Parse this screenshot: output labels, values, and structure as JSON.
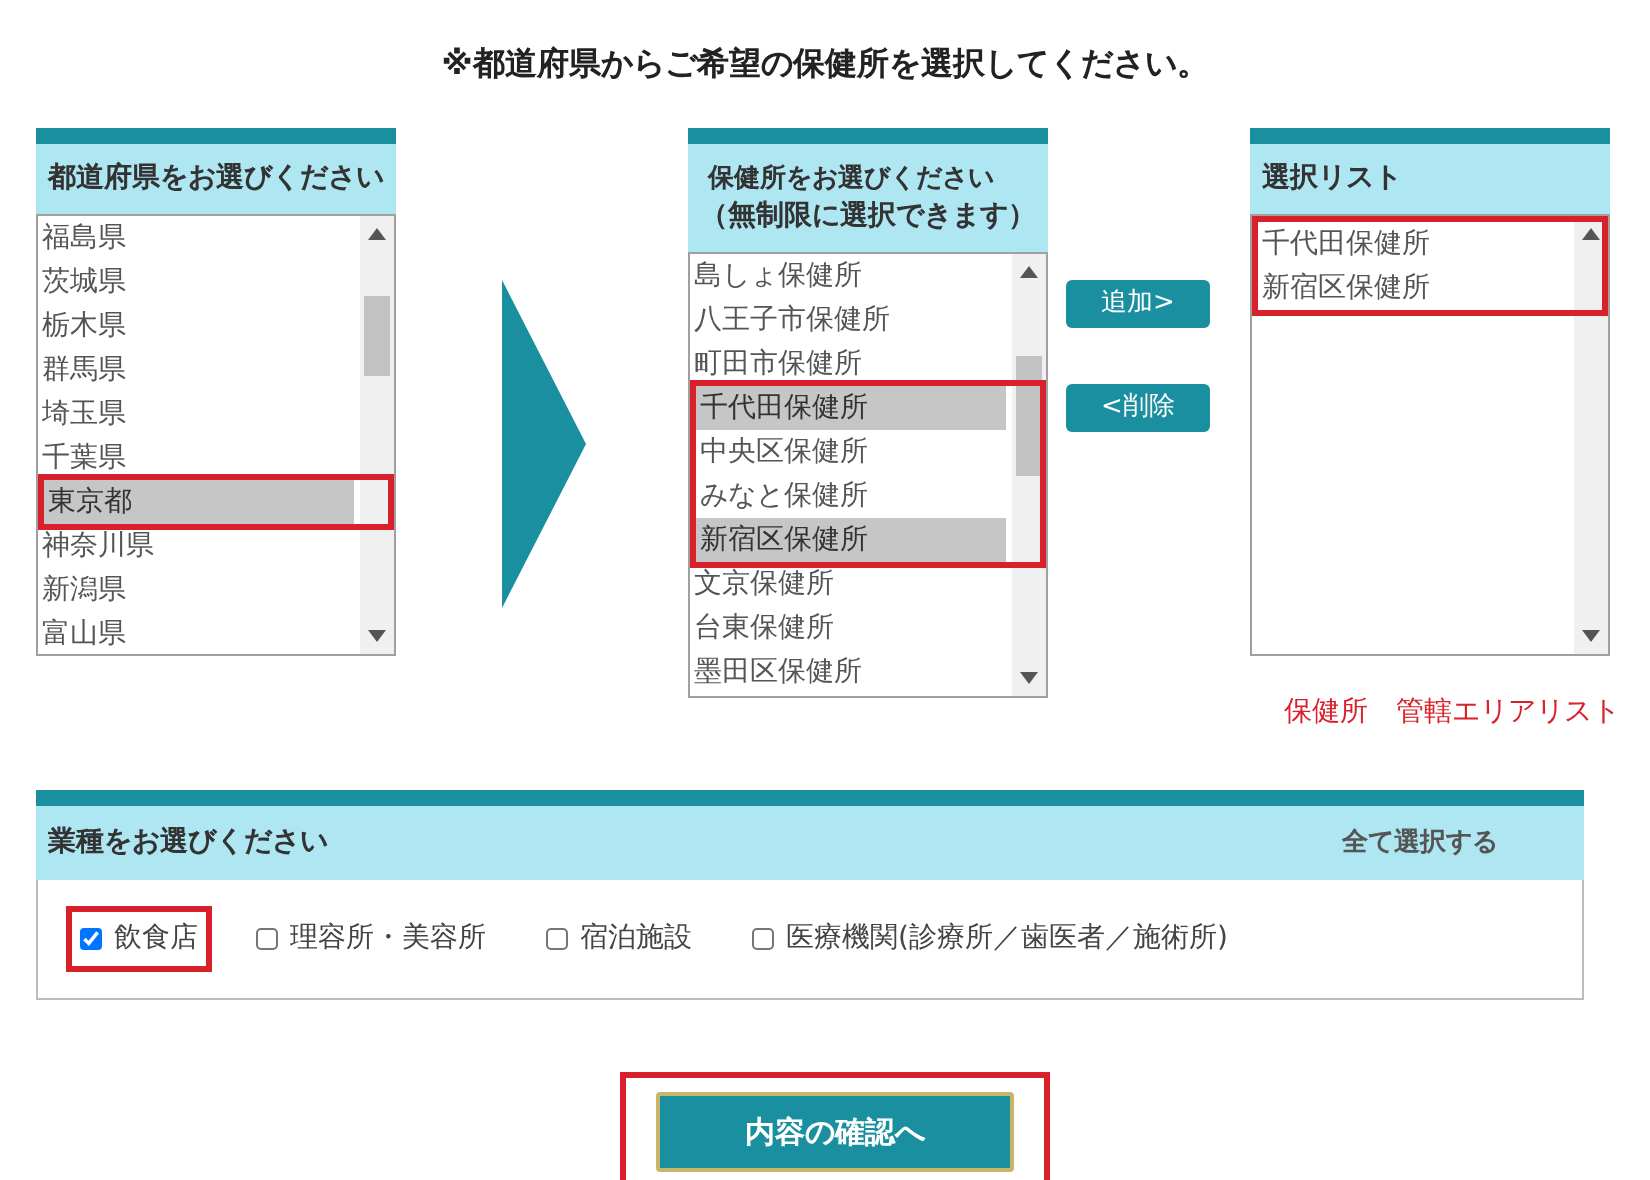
{
  "heading": "※都道府県からご希望の保健所を選択してください。",
  "prefecture_panel": {
    "title": "都道府県をお選びください",
    "items": [
      {
        "label": "福島県",
        "selected": false,
        "annotated": false
      },
      {
        "label": "茨城県",
        "selected": false,
        "annotated": false
      },
      {
        "label": "栃木県",
        "selected": false,
        "annotated": false
      },
      {
        "label": "群馬県",
        "selected": false,
        "annotated": false
      },
      {
        "label": "埼玉県",
        "selected": false,
        "annotated": false
      },
      {
        "label": "千葉県",
        "selected": false,
        "annotated": false
      },
      {
        "label": "東京都",
        "selected": true,
        "annotated": true
      },
      {
        "label": "神奈川県",
        "selected": false,
        "annotated": false
      },
      {
        "label": "新潟県",
        "selected": false,
        "annotated": false
      },
      {
        "label": "富山県",
        "selected": false,
        "annotated": false
      }
    ]
  },
  "office_panel": {
    "title": "保健所をお選びください",
    "subtitle": "（無制限に選択できます）",
    "items": [
      {
        "label": "島しょ保健所",
        "selected": false,
        "annotated": false
      },
      {
        "label": "八王子市保健所",
        "selected": false,
        "annotated": false
      },
      {
        "label": "町田市保健所",
        "selected": false,
        "annotated": false
      },
      {
        "label": "千代田保健所",
        "selected": true,
        "annotated": true
      },
      {
        "label": "中央区保健所",
        "selected": false,
        "annotated": true
      },
      {
        "label": "みなと保健所",
        "selected": false,
        "annotated": true
      },
      {
        "label": "新宿区保健所",
        "selected": true,
        "annotated": true
      },
      {
        "label": "文京保健所",
        "selected": false,
        "annotated": false
      },
      {
        "label": "台東保健所",
        "selected": false,
        "annotated": false
      },
      {
        "label": "墨田区保健所",
        "selected": false,
        "annotated": false
      }
    ]
  },
  "transfer_buttons": [
    "追加>",
    "<削除"
  ],
  "selection_panel": {
    "title": "選択リスト",
    "items": [
      {
        "label": "千代田保健所",
        "selected": false,
        "annotated": true
      },
      {
        "label": "新宿区保健所",
        "selected": false,
        "annotated": true
      }
    ]
  },
  "links": [
    "保健所",
    "管轄エリアリスト"
  ],
  "category_panel": {
    "title": "業種をお選びください",
    "select_all": "全て選択する",
    "options": [
      {
        "label": "飲食店",
        "checked": true,
        "annotated": true
      },
      {
        "label": "理容所・美容所",
        "checked": false,
        "annotated": false
      },
      {
        "label": "宿泊施設",
        "checked": false,
        "annotated": false
      },
      {
        "label": "医療機関(診療所／歯医者／施術所)",
        "checked": false,
        "annotated": false
      }
    ]
  },
  "confirm_button": {
    "label": "内容の確認へ",
    "annotated": true
  }
}
